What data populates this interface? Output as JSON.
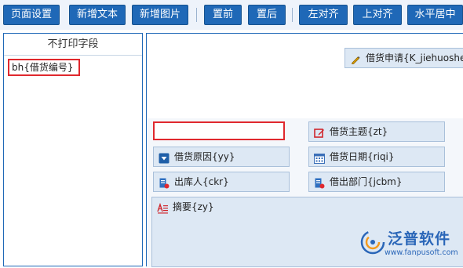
{
  "toolbar": {
    "page_setup": "页面设置",
    "add_text": "新增文本",
    "add_image": "新增图片",
    "bring_front": "置前",
    "send_back": "置后",
    "align_left": "左对齐",
    "align_top": "上对齐",
    "center_horizontal": "水平居中"
  },
  "left_panel": {
    "title": "不打印字段",
    "fields": [
      "bh{借货编号}"
    ]
  },
  "design": {
    "header_field": "借货申请{K_jiehuoshe",
    "fields": [
      {
        "label": "借货主题{zt}",
        "icon": "edit-icon"
      },
      {
        "label": "借货原因{yy}",
        "icon": "dropdown-icon"
      },
      {
        "label": "借货日期{riqi}",
        "icon": "calendar-icon"
      },
      {
        "label": "出库人{ckr}",
        "icon": "person-doc-icon"
      },
      {
        "label": "借出部门{jcbm}",
        "icon": "person-doc-icon"
      },
      {
        "label": "摘要{zy}",
        "icon": "text-area-icon"
      }
    ]
  },
  "logo": {
    "name": "泛普软件",
    "url": "www.fanpusoft.com"
  },
  "colors": {
    "accent": "#1f68b7",
    "highlight": "#e0282e",
    "field_bg": "#dde8f4"
  }
}
